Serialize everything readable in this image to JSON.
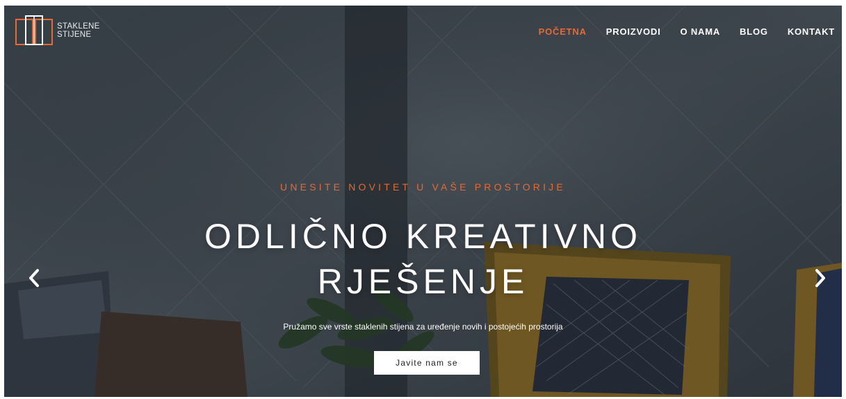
{
  "brand": {
    "name_line1": "STAKLENE",
    "name_line2": "STIJENE",
    "logo_icon": "glass-wall-frame-logo"
  },
  "nav": {
    "items": [
      {
        "label": "POČETNA",
        "active": true
      },
      {
        "label": "PROIZVODI",
        "active": false
      },
      {
        "label": "O NAMA",
        "active": false
      },
      {
        "label": "BLOG",
        "active": false
      },
      {
        "label": "KONTAKT",
        "active": false
      }
    ]
  },
  "hero": {
    "eyebrow": "UNESITE NOVITET U VAŠE PROSTORIJE",
    "headline_line1": "ODLIČNO KREATIVNO",
    "headline_line2": "RJEŠENJE",
    "subtitle": "Pružamo sve vrste staklenih stijena za uređenje novih i postojećih prostorija",
    "cta_label": "Javite nam se",
    "prev_icon": "chevron-left-icon",
    "next_icon": "chevron-right-icon"
  },
  "colors": {
    "accent": "#e56a35",
    "text": "#ffffff",
    "button_bg": "#ffffff"
  }
}
